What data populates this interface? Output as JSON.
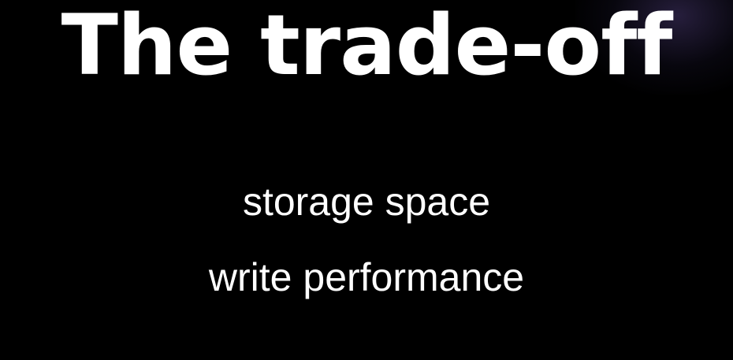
{
  "slide": {
    "title": "The trade-off",
    "points": [
      "storage space",
      "write performance"
    ]
  },
  "colors": {
    "background": "#000000",
    "text": "#ffffff",
    "corner_glow": "#463770"
  }
}
